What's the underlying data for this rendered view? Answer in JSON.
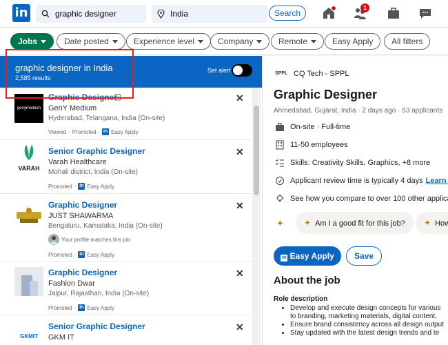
{
  "topbar": {
    "logo": "in",
    "search_value": "graphic designer",
    "location_value": "India",
    "search_button": "Search",
    "home_badge": "",
    "network_badge": "1"
  },
  "filters": {
    "jobs": "Jobs",
    "date_posted": "Date posted",
    "experience_level": "Experience level",
    "company": "Company",
    "remote": "Remote",
    "easy_apply": "Easy Apply",
    "all_filters": "All filters"
  },
  "results": {
    "title": "graphic designer in India",
    "count": "2,585 results",
    "set_alert": "Set alert"
  },
  "jobs": [
    {
      "title": "Graphic Designer",
      "company": "GenY Medium",
      "location": "Hyderabad, Telangana, India (On-site)",
      "meta1": "Viewed",
      "meta2": "Promoted",
      "meta3": "Easy Apply",
      "logo": "genymedium"
    },
    {
      "title": "Senior Graphic Designer",
      "company": "Varah Healthcare",
      "location": "Mohali district, India (On-site)",
      "meta2": "Promoted",
      "meta3": "Easy Apply",
      "logo": "VARAH"
    },
    {
      "title": "Graphic Designer",
      "company": "JUST SHAWARMA",
      "location": "Bengaluru, Karnataka, India (On-site)",
      "insight": "Your profile matches this job",
      "meta2": "Promoted",
      "meta3": "Easy Apply"
    },
    {
      "title": "Graphic Designer",
      "company": "Fashion Dwar",
      "location": "Jaipur, Rajasthan, India (On-site)",
      "meta2": "Promoted",
      "meta3": "Easy Apply"
    },
    {
      "title": "Senior Graphic Designer",
      "company": "GKM IT",
      "logo": "GKMIT"
    }
  ],
  "detail": {
    "company_logo": "SPPL",
    "company": "CQ Tech - SPPL",
    "title": "Graphic Designer",
    "subtitle": "Ahmedabad, Gujarat, India · 2 days ago · 53 applicants",
    "workplace": "On-site · Full-time",
    "employees": "11-50 employees",
    "skills": "Skills: Creativity Skills, Graphics, +8 more",
    "review_time": "Applicant review time is typically 4 days",
    "learn_more": "Learn more",
    "compare": "See how you compare to over 100 other applicants.",
    "chip1": "Am I a good fit for this job?",
    "chip2": "How",
    "easy_apply": "Easy Apply",
    "save": "Save",
    "about": "About the job",
    "role": "Role description",
    "bullets": [
      "Develop and execute design concepts for various",
      "to branding, marketing materials, digital content,",
      "Ensure brand consistency across all design output",
      "Stay updated with the latest design trends and te"
    ]
  },
  "colors": {
    "brand": "#0a66c2",
    "active_filter": "#01754f",
    "highlight_box": "#e3201b"
  }
}
